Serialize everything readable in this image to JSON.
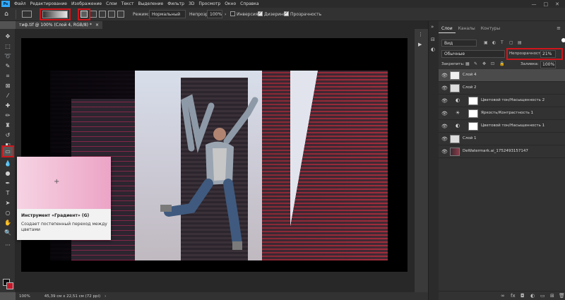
{
  "app": {
    "logo": "Ps"
  },
  "menu": [
    "Файл",
    "Редактирование",
    "Изображение",
    "Слои",
    "Текст",
    "Выделение",
    "Фильтр",
    "3D",
    "Просмотр",
    "Окно",
    "Справка"
  ],
  "window_controls": [
    "—",
    "□",
    "✕"
  ],
  "options": {
    "mode_label": "Режим:",
    "mode_value": "Нормальный",
    "opacity_label": "Непрозр.:",
    "opacity_value": "100%",
    "inverse_label": "Инверсия",
    "inverse_checked": false,
    "dither_label": "Дизеринг",
    "dither_checked": true,
    "transparency_label": "Прозрачность",
    "transparency_checked": true,
    "highlight_color": "#d0151b"
  },
  "document": {
    "tab_title": "тиф.tif @ 100% (Слой 4, RGB/8) *",
    "tab_close": "×"
  },
  "tooltip": {
    "title": "Инструмент «Градиент» (G)",
    "description": "Создает постепенный переход между цветами",
    "gradient_from": "#f6d3e3",
    "gradient_to": "#eca4c6"
  },
  "status": {
    "zoom": "100%",
    "size": "45,39 см x 22,51 см (72 ppi)"
  },
  "colors": {
    "foreground": "#111111",
    "background": "#c51a2b"
  },
  "panel": {
    "tabs": [
      "Слои",
      "Каналы",
      "Контуры"
    ],
    "active_tab": "Слои",
    "filter_value": "Вид",
    "blend_mode": "Обычные",
    "opacity_label": "Непрозрачность:",
    "opacity_value": "21%",
    "lock_label": "Закрепить:",
    "fill_label": "Заливка:",
    "fill_value": "100%",
    "layers": [
      {
        "name": "Слой 4",
        "visible": true,
        "selected": true,
        "kind": "pixel-white"
      },
      {
        "name": "Слой 2",
        "visible": true,
        "selected": false,
        "kind": "pixel-small"
      },
      {
        "name": "Цветовой тон/Насыщенность 2",
        "visible": true,
        "selected": false,
        "kind": "adjustment"
      },
      {
        "name": "Яркость/Контрастность 1",
        "visible": true,
        "selected": false,
        "kind": "adjustment"
      },
      {
        "name": "Цветовой тон/Насыщенность 1",
        "visible": true,
        "selected": false,
        "kind": "adjustment"
      },
      {
        "name": "Слой 1",
        "visible": true,
        "selected": false,
        "kind": "pixel-small"
      },
      {
        "name": "DeWatermark.ai_1752493157147",
        "visible": true,
        "selected": false,
        "kind": "photo"
      }
    ],
    "bottom_icons": [
      "link-icon",
      "fx-icon",
      "mask-icon",
      "adjustment-icon",
      "folder-icon",
      "new-layer-icon",
      "trash-icon"
    ]
  }
}
